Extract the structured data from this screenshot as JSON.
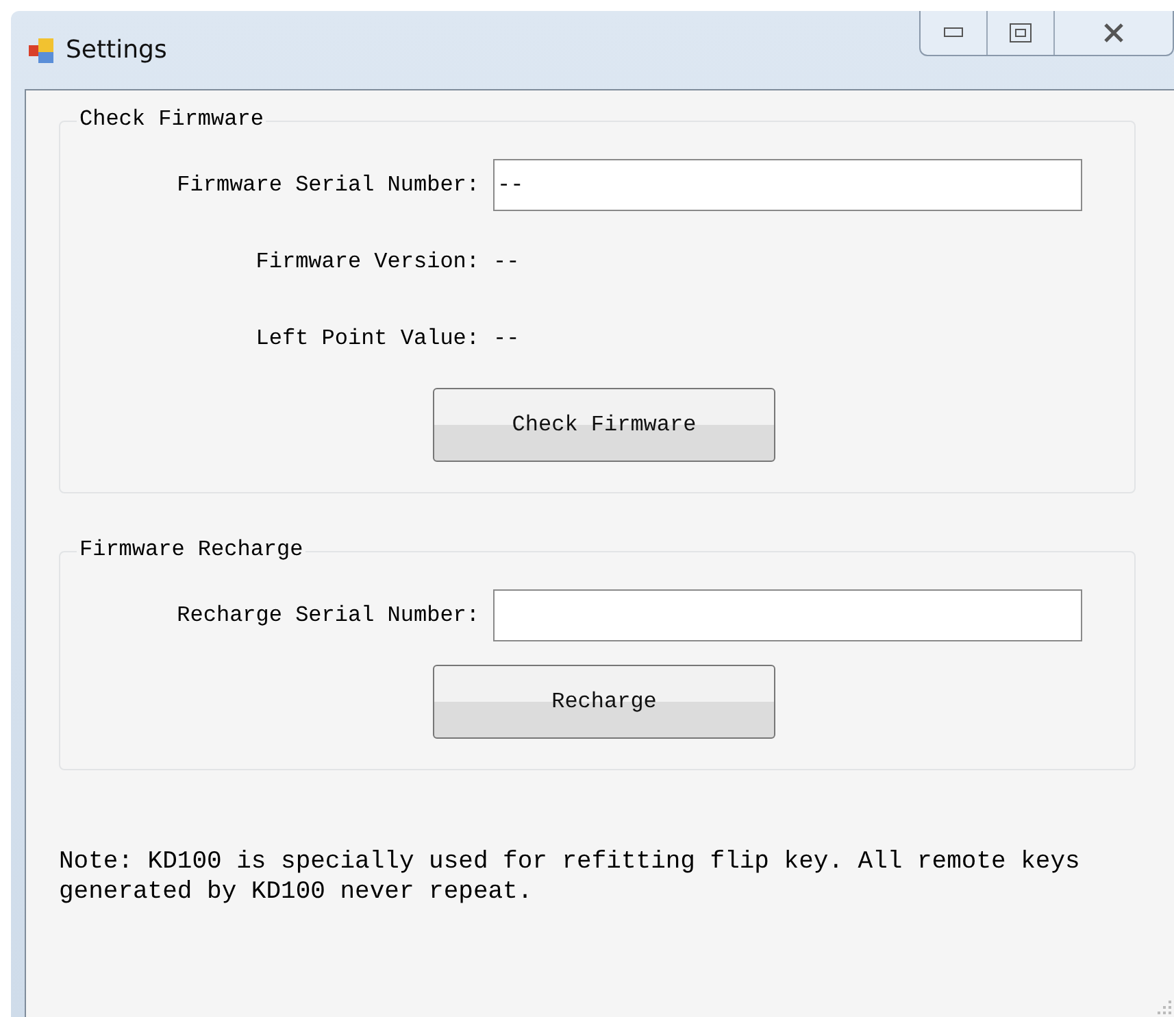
{
  "window": {
    "title": "Settings"
  },
  "check_firmware": {
    "legend": "Check Firmware",
    "fields": [
      {
        "kind": "input",
        "label": "Firmware Serial Number:",
        "value": "--"
      },
      {
        "kind": "text",
        "label": "Firmware Version:",
        "value": "--"
      },
      {
        "kind": "text",
        "label": "Left Point Value:",
        "value": "--"
      }
    ],
    "button": "Check Firmware"
  },
  "firmware_recharge": {
    "legend": "Firmware Recharge",
    "fields": [
      {
        "kind": "input",
        "label": "Recharge Serial Number:"
      }
    ],
    "button": "Recharge"
  },
  "note": "Note: KD100 is specially used for refitting flip key. All remote keys generated by KD100 never repeat."
}
